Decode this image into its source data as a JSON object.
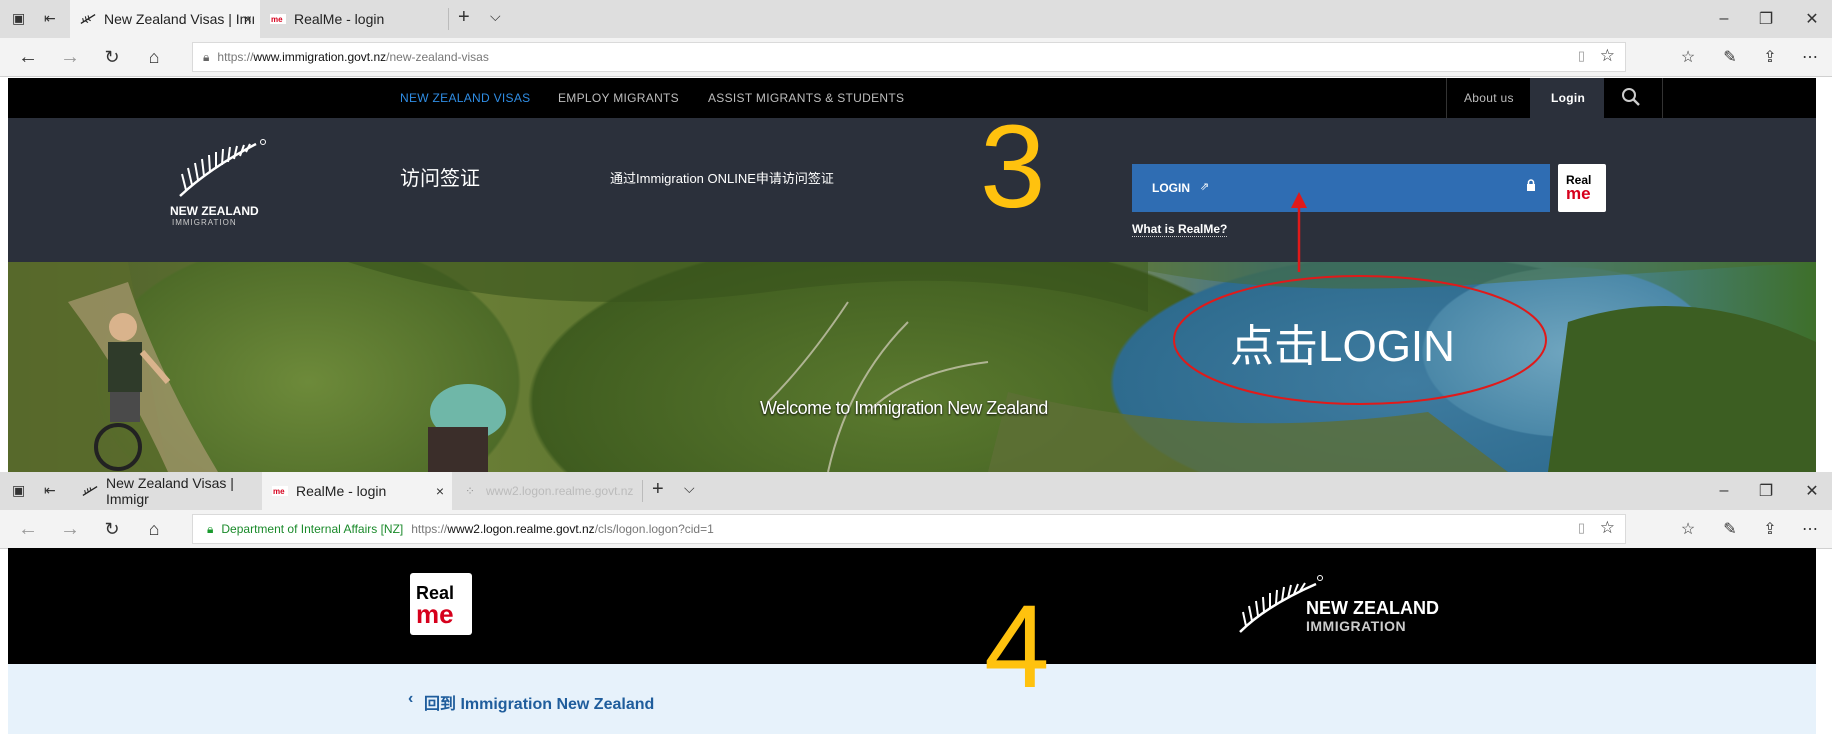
{
  "window1": {
    "tabs": [
      {
        "label": "New Zealand Visas | Imı",
        "close": "×"
      },
      {
        "label": "RealMe - login"
      }
    ],
    "new_tab": "+",
    "url_prefix": "https://",
    "url_host": "www.immigration.govt.nz",
    "url_path": "/new-zealand-visas"
  },
  "site": {
    "nav": [
      "NEW ZEALAND VISAS",
      "EMPLOY MIGRANTS",
      "ASSIST MIGRANTS & STUDENTS"
    ],
    "about": "About us",
    "login": "Login",
    "logo_line1": "NEW ZEALAND",
    "logo_line2": "IMMIGRATION",
    "heading": "访问签证",
    "subheading": "通过Immigration ONLINE申请访问签证",
    "login_button": "LOGIN",
    "what_is_realme": "What is RealMe?",
    "welcome": "Welcome to Immigration New Zealand",
    "realme_logo_top": "Real",
    "realme_logo_bottom": "me"
  },
  "annotations": {
    "step3": "3",
    "step4": "4",
    "click_login": "点击LOGIN",
    "arrow_color": "#e01a1a",
    "step_color": "#ffc20e"
  },
  "window2": {
    "tabs": [
      {
        "label": "New Zealand Visas | Immigr"
      },
      {
        "label": "RealMe - login",
        "close": "×"
      },
      {
        "label": "www2.logon.realme.govt.nz"
      }
    ],
    "new_tab": "+",
    "cert": "Department of Internal Affairs [NZ]",
    "url_prefix": "https://",
    "url_host": "www2.logon.realme.govt.nz",
    "url_path": "/cls/logon.logon?cid=1"
  },
  "realme_page": {
    "logo_top": "Real",
    "logo_bottom": "me",
    "brand_line1": "NEW ZEALAND",
    "brand_line2": "IMMIGRATION",
    "back_link": "回到 Immigration New Zealand"
  }
}
